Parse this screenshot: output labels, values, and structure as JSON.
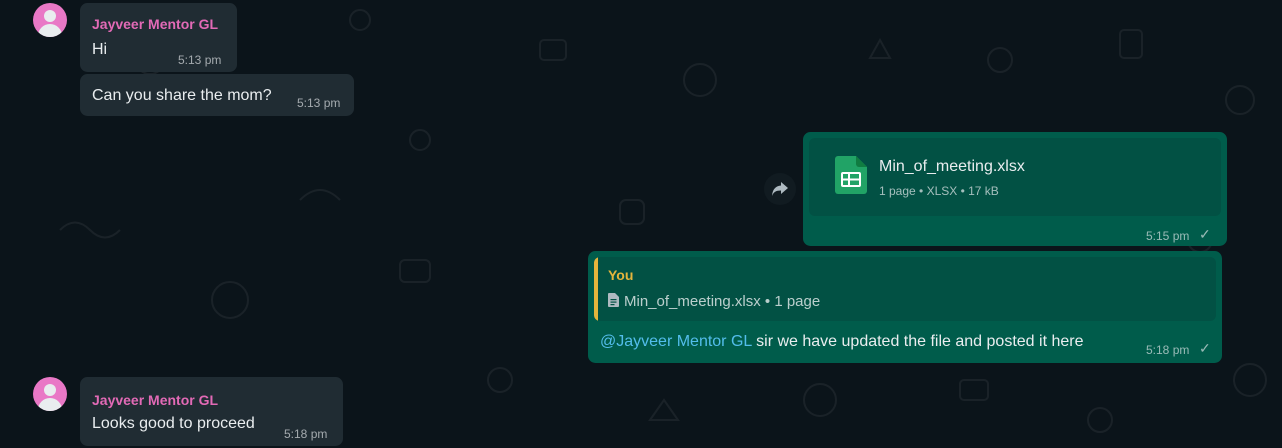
{
  "messages": [
    {
      "sender": "Jayveer Mentor GL",
      "text": "Hi",
      "time": "5:13 pm"
    },
    {
      "text": "Can you share the mom?",
      "time": "5:13 pm"
    },
    {
      "file": {
        "name": "Min_of_meeting.xlsx",
        "meta": "1 page • XLSX • 17 kB",
        "icon": "spreadsheet-icon"
      },
      "time": "5:15 pm",
      "status": "sent"
    },
    {
      "reply_to": {
        "author": "You",
        "text": "Min_of_meeting.xlsx • 1 page"
      },
      "mention": "@Jayveer Mentor GL",
      "text": " sir we have updated the file and posted it here",
      "time": "5:18 pm",
      "status": "sent"
    },
    {
      "sender": "Jayveer Mentor GL",
      "text": "Looks good to proceed",
      "time": "5:18 pm"
    }
  ],
  "icons": {
    "forward": "forward-icon",
    "check": "✓",
    "doc": "document-icon"
  },
  "colors": {
    "background": "#0b141a",
    "incoming": "#202c33",
    "outgoing": "#005c4b",
    "sender": "#e26ab6",
    "quote_author": "#e5b53c",
    "mention": "#53bdeb",
    "spreadsheet": "#21a366"
  }
}
